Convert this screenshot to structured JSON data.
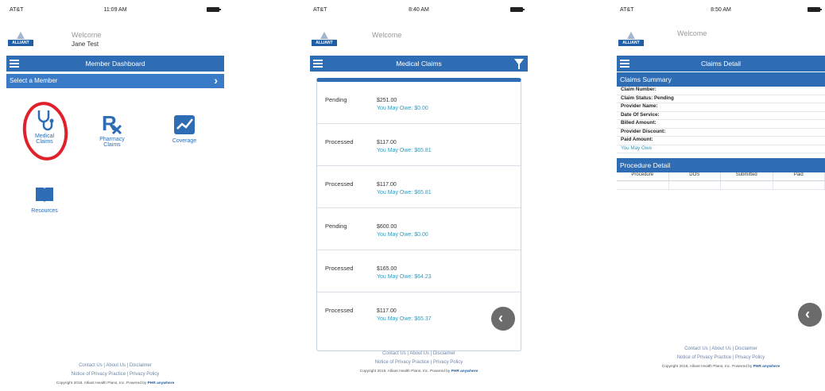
{
  "phone1": {
    "status": {
      "carrier": "AT&T",
      "time": "11:09 AM"
    },
    "logo": {
      "word": "ALLIANT"
    },
    "welcome": "Welcome",
    "username": "Jane Test",
    "nav_title": "Member Dashboard",
    "select_member": "Select a Member",
    "tiles": [
      {
        "label_line1": "Medical",
        "label_line2": "Claims",
        "icon": "stethoscope-icon"
      },
      {
        "label_line1": "Pharmacy",
        "label_line2": "Claims",
        "icon": "rx-icon"
      },
      {
        "label_line1": "Coverage",
        "label_line2": "",
        "icon": "coverage-chart-icon"
      },
      {
        "label_line1": "Resources",
        "label_line2": "",
        "icon": "book-icon"
      }
    ],
    "highlight_color": "#e0202a"
  },
  "phone2": {
    "status": {
      "carrier": "AT&T",
      "time": "8:40 AM"
    },
    "logo": {
      "word": "ALLIANT"
    },
    "welcome": "Welcome",
    "nav_title": "Medical Claims",
    "claims": [
      {
        "status": "Pending",
        "amount": "$251.00",
        "owe": "You May Owe: $0.00"
      },
      {
        "status": "Processed",
        "amount": "$117.00",
        "owe": "You May Owe: $65.81"
      },
      {
        "status": "Processed",
        "amount": "$117.00",
        "owe": "You May Owe: $65.81"
      },
      {
        "status": "Pending",
        "amount": "$600.00",
        "owe": "You May Owe: $0.00"
      },
      {
        "status": "Processed",
        "amount": "$165.00",
        "owe": "You May Owe: $64.23"
      },
      {
        "status": "Processed",
        "amount": "$117.00",
        "owe": "You May Owe: $65.37"
      }
    ]
  },
  "phone3": {
    "status": {
      "carrier": "AT&T",
      "time": "8:50 AM"
    },
    "logo": {
      "word": "ALLIANT"
    },
    "welcome": "Welcome",
    "nav_title": "Claims Detail",
    "summary_title": "Claims Summary",
    "summary_lines": [
      "Claim Number:",
      "Claim Status: Pending",
      "Provider Name:",
      "Date Of Service:",
      "Billed Amount:",
      "Provider Discount:",
      "Paid Amount:"
    ],
    "owe_line": "You May Owe",
    "procedure_title": "Procedure Detail",
    "procedure_columns": [
      "Procedure",
      "DOS",
      "Submitted",
      "Paid"
    ]
  },
  "footer": {
    "links": "Contact Us  |  About Us  |  Disclaimer",
    "links2": "Notice of Privacy Practice  |  Privacy Policy",
    "copyright": "Copyright 2018, Alliant Health Plans, Inc. Powered by",
    "powered_brand": "PHR anywhere"
  },
  "colors": {
    "primary": "#2e6db4",
    "accent": "#2e9bbf"
  }
}
